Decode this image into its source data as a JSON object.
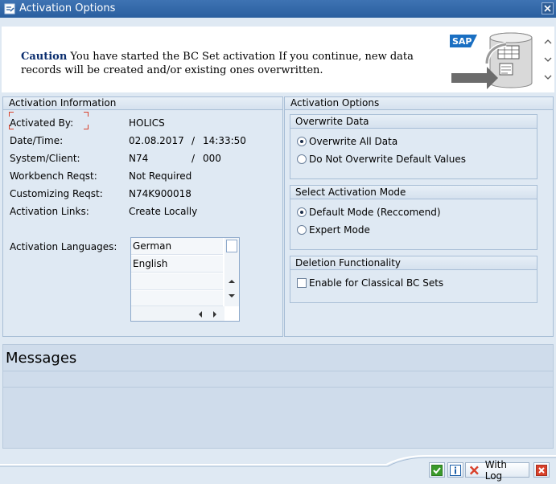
{
  "window": {
    "title": "Activation Options"
  },
  "header": {
    "caution_word": "Caution",
    "caution_message": " You have started the BC Set activation If you continue, new data records will be created and/or existing ones overwritten.",
    "logo_text": "SAP"
  },
  "activation_info": {
    "title": "Activation Information",
    "rows": [
      {
        "label": "Activated By:",
        "value": "HOLICS"
      },
      {
        "label": "Date/Time:",
        "value": "02.08.2017",
        "sep": "/",
        "value2": "14:33:50"
      },
      {
        "label": "System/Client:",
        "value": "N74",
        "sep": "/",
        "value2": "000"
      },
      {
        "label": "Workbench Reqst:",
        "value": "Not Required"
      },
      {
        "label": "Customizing Reqst:",
        "value": "N74K900018"
      },
      {
        "label": "Activation Links:",
        "value": "Create Locally"
      }
    ],
    "languages_label": "Activation Languages:",
    "languages": [
      "German",
      "English"
    ]
  },
  "activation_options": {
    "title": "Activation Options",
    "overwrite": {
      "title": "Overwrite Data",
      "options": [
        "Overwrite All Data",
        "Do Not Overwrite Default Values"
      ],
      "selected": "Overwrite All Data"
    },
    "mode": {
      "title": "Select Activation Mode",
      "options": [
        "Default Mode (Reccomend)",
        "Expert Mode"
      ],
      "selected": "Default Mode (Reccomend)"
    },
    "deletion": {
      "title": "Deletion Functionality",
      "checkbox_label": "Enable for Classical BC Sets",
      "checked": false
    }
  },
  "messages": {
    "title": "Messages"
  },
  "footer": {
    "with_log_label": "With Log"
  },
  "colors": {
    "titlebar": "#2a5f9f",
    "panel_bg": "#dfe9f3",
    "confirm_green": "#3a9a2a",
    "cancel_red": "#d9412b",
    "info_blue": "#1a5ea8"
  }
}
